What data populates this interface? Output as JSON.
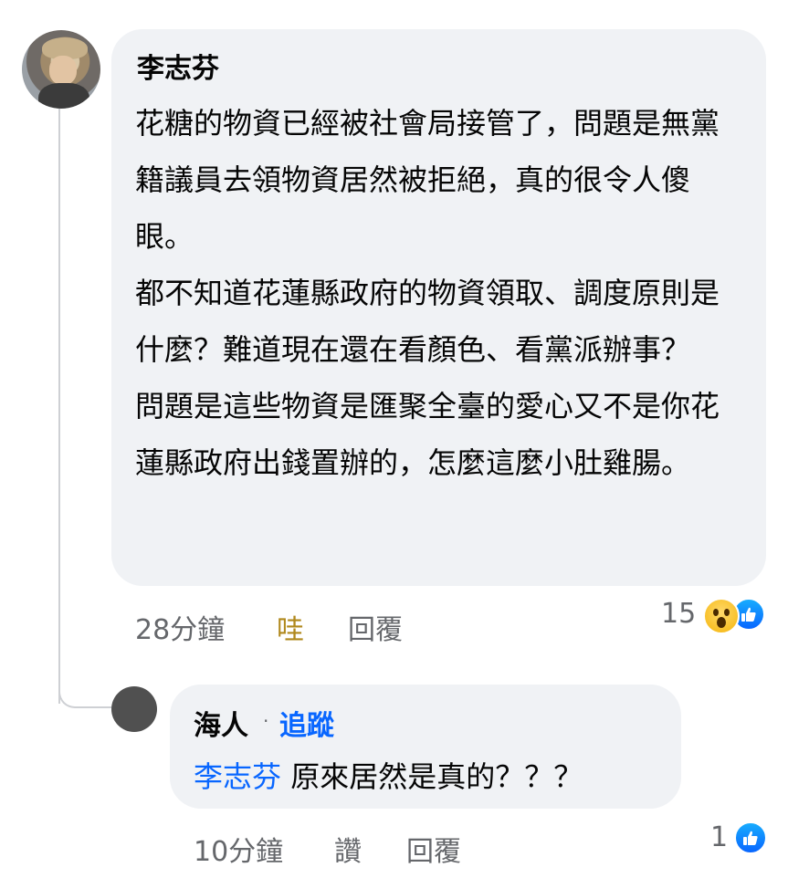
{
  "comment": {
    "author": "李志芬",
    "paragraphs": [
      "花糖的物資已經被社會局接管了，問題是無黨籍議員去領物資居然被拒絕，真的很令人傻眼。",
      "都不知道花蓮縣政府的物資領取、調度原則是什麼？難道現在還在看顏色、看黨派辦事？",
      "問題是這些物資是匯聚全臺的愛心又不是你花蓮縣政府出錢置辦的，怎麼這麼小肚雞腸。"
    ],
    "time": "28分鐘",
    "reaction_label": "哇",
    "reply_label": "回覆",
    "reaction_count": "15",
    "reaction_icons": [
      "wow-icon",
      "like-icon"
    ]
  },
  "reply": {
    "author": "海人",
    "separator": "·",
    "follow_label": "追蹤",
    "mention": "李志芬",
    "text": " 原來居然是真的？？？",
    "time": "10分鐘",
    "like_label": "讚",
    "reply_label": "回覆",
    "reaction_count": "1",
    "reaction_icons": [
      "like-icon"
    ]
  },
  "colors": {
    "link": "#0866ff",
    "bubble": "#f0f2f5",
    "meta": "#65676b",
    "wow_text": "#b0881c"
  }
}
